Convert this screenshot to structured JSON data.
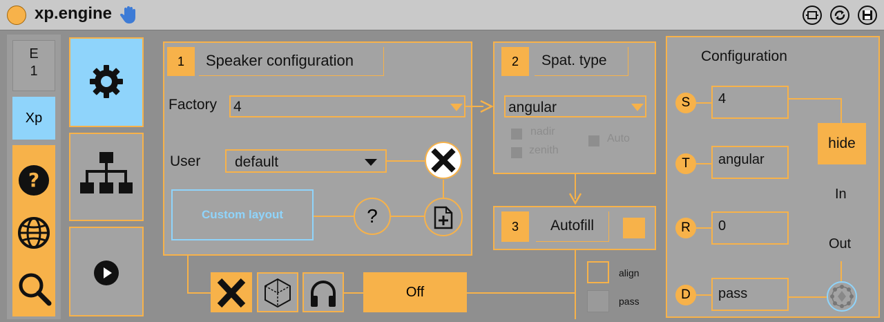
{
  "app": {
    "title": "xp.engine"
  },
  "nav": {
    "e_label": "E",
    "e_value": "1",
    "xp_label": "Xp"
  },
  "speaker": {
    "step": "1",
    "title": "Speaker configuration",
    "factory_label": "Factory",
    "factory_value": "4",
    "user_label": "User",
    "user_value": "default",
    "custom_layout": "Custom layout",
    "help": "?"
  },
  "spat": {
    "step": "2",
    "title": "Spat. type",
    "value": "angular",
    "nadir": "nadir",
    "zenith": "zenith",
    "auto": "Auto"
  },
  "autofill": {
    "step": "3",
    "title": "Autofill"
  },
  "bottom": {
    "off": "Off",
    "align": "align",
    "pass": "pass"
  },
  "config": {
    "title": "Configuration",
    "rows": [
      {
        "letter": "S",
        "value": "4"
      },
      {
        "letter": "T",
        "value": "angular"
      },
      {
        "letter": "R",
        "value": "0"
      },
      {
        "letter": "D",
        "value": "pass"
      }
    ],
    "hide": "hide",
    "in": "In",
    "out": "Out"
  },
  "colors": {
    "accent": "#f7b24a",
    "active": "#8fd4fb",
    "panel": "#a3a3a3",
    "background": "#8f8f8f"
  }
}
